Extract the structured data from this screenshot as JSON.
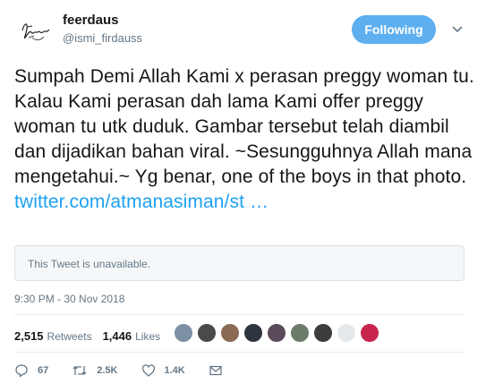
{
  "user": {
    "name": "feerdaus",
    "handle": "@ismi_firdauss"
  },
  "follow_button": {
    "label": "Following",
    "color": "#5eaff0"
  },
  "tweet": {
    "text": "Sumpah Demi Allah Kami x perasan preggy woman tu. Kalau Kami perasan dah lama Kami offer preggy woman tu utk duduk. Gambar tersebut telah diambil dan dijadikan bahan viral. ~Sesungguhnya Allah mana mengetahui.~ Yg benar, one of the boys in that photo. ",
    "link": "twitter.com/atmanasiman/st …",
    "link_color": "#1da1f2"
  },
  "quoted": {
    "unavailable_text": "This Tweet is unavailable."
  },
  "timestamp": "9:30 PM - 30 Nov 2018",
  "stats": {
    "retweets_count": "2,515",
    "retweets_label": "Retweets",
    "likes_count": "1,446",
    "likes_label": "Likes"
  },
  "actions": {
    "replies": "67",
    "retweets": "2.5K",
    "likes": "1.4K"
  },
  "icons": {
    "caret": "chevron-down-icon",
    "reply": "reply-icon",
    "retweet": "retweet-icon",
    "like": "heart-icon",
    "message": "envelope-icon"
  }
}
